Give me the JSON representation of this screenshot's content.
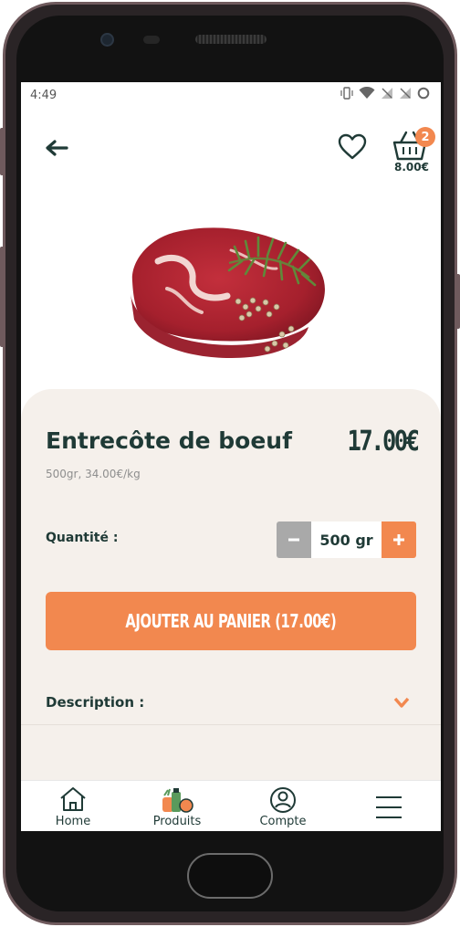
{
  "status_bar": {
    "time": "4:49"
  },
  "header": {
    "cart_badge_count": "2",
    "cart_total": "8.00€"
  },
  "product": {
    "name": "Entrecôte de boeuf",
    "price": "17.00€",
    "subtitle": "500gr, 34.00€/kg",
    "quantity_label": "Quantité :",
    "quantity_value": "500 gr",
    "add_to_cart_label": "AJOUTER AU PANIER (17.00€)",
    "description_label": "Description :"
  },
  "bottom_nav": {
    "items": [
      {
        "label": "Home",
        "icon": "home-icon"
      },
      {
        "label": "Produits",
        "icon": "products-icon"
      },
      {
        "label": "Compte",
        "icon": "account-icon"
      },
      {
        "label": "",
        "icon": "menu-icon"
      }
    ]
  },
  "colors": {
    "accent": "#f2884f",
    "dark_text": "#1f3a36",
    "sheet_background": "#f5f0eb",
    "stepper_minus": "#a9a9a9"
  }
}
